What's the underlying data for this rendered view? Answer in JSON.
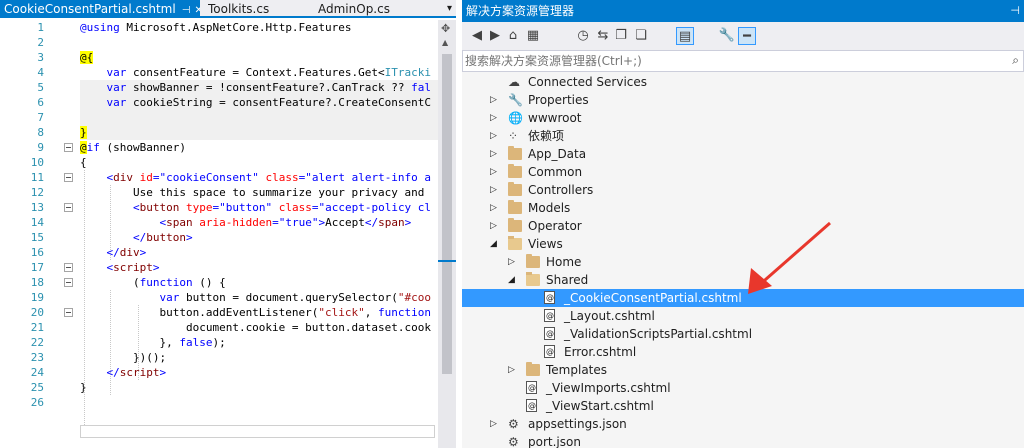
{
  "editor": {
    "tabs": [
      {
        "label": "CookieConsentPartial.cshtml",
        "active": true
      },
      {
        "label": "Toolkits.cs",
        "active": false
      },
      {
        "label": "AdminOp.cs",
        "active": false
      }
    ],
    "lines": [
      {
        "n": "1",
        "fold": false,
        "tokens": [
          [
            "t-kw",
            "@using"
          ],
          [
            "t-txt",
            " Microsoft.AspNetCore.Http.Features"
          ]
        ]
      },
      {
        "n": "2",
        "fold": false,
        "tokens": []
      },
      {
        "n": "3",
        "fold": false,
        "tokens": [
          [
            "t-razor",
            "@{"
          ]
        ]
      },
      {
        "n": "4",
        "fold": false,
        "tokens": [
          [
            "t-txt",
            "    "
          ],
          [
            "t-kw",
            "var"
          ],
          [
            "t-txt",
            " consentFeature = Context.Features.Get<"
          ],
          [
            "t-tp",
            "ITracki"
          ]
        ]
      },
      {
        "n": "5",
        "fold": false,
        "tokens": [
          [
            "t-txt",
            "    "
          ],
          [
            "t-kw",
            "var"
          ],
          [
            "t-txt",
            " showBanner = !consentFeature?.CanTrack ?? "
          ],
          [
            "t-kw",
            "fal"
          ]
        ]
      },
      {
        "n": "6",
        "fold": false,
        "tokens": [
          [
            "t-txt",
            "    "
          ],
          [
            "t-kw",
            "var"
          ],
          [
            "t-txt",
            " cookieString = consentFeature?.CreateConsentC"
          ]
        ]
      },
      {
        "n": "7",
        "fold": false,
        "tokens": []
      },
      {
        "n": "8",
        "fold": false,
        "tokens": [
          [
            "t-razor",
            "}"
          ]
        ]
      },
      {
        "n": "9",
        "fold": true,
        "tokens": [
          [
            "t-at",
            "@"
          ],
          [
            "t-kw",
            "if"
          ],
          [
            "t-txt",
            " (showBanner)"
          ]
        ]
      },
      {
        "n": "10",
        "fold": false,
        "tokens": [
          [
            "t-txt",
            "{"
          ]
        ]
      },
      {
        "n": "11",
        "fold": true,
        "tokens": [
          [
            "t-txt",
            "    "
          ],
          [
            "t-punc",
            "<"
          ],
          [
            "t-tag",
            "div"
          ],
          [
            "t-txt",
            " "
          ],
          [
            "t-attr",
            "id"
          ],
          [
            "t-punc",
            "="
          ],
          [
            "t-kw",
            "\"cookieConsent\""
          ],
          [
            "t-txt",
            " "
          ],
          [
            "t-attr",
            "class"
          ],
          [
            "t-punc",
            "="
          ],
          [
            "t-kw",
            "\"alert alert-info a"
          ]
        ]
      },
      {
        "n": "12",
        "fold": false,
        "tokens": [
          [
            "t-txt",
            "        Use this space to summarize your privacy and "
          ]
        ]
      },
      {
        "n": "13",
        "fold": true,
        "tokens": [
          [
            "t-txt",
            "        "
          ],
          [
            "t-punc",
            "<"
          ],
          [
            "t-tag",
            "button"
          ],
          [
            "t-txt",
            " "
          ],
          [
            "t-attr",
            "type"
          ],
          [
            "t-punc",
            "="
          ],
          [
            "t-kw",
            "\"button\""
          ],
          [
            "t-txt",
            " "
          ],
          [
            "t-attr",
            "class"
          ],
          [
            "t-punc",
            "="
          ],
          [
            "t-kw",
            "\"accept-policy cl"
          ]
        ]
      },
      {
        "n": "14",
        "fold": false,
        "tokens": [
          [
            "t-txt",
            "            "
          ],
          [
            "t-punc",
            "<"
          ],
          [
            "t-tag",
            "span"
          ],
          [
            "t-txt",
            " "
          ],
          [
            "t-attr",
            "aria-hidden"
          ],
          [
            "t-punc",
            "="
          ],
          [
            "t-kw",
            "\"true\""
          ],
          [
            "t-punc",
            ">"
          ],
          [
            "t-txt",
            "Accept"
          ],
          [
            "t-punc",
            "</"
          ],
          [
            "t-tag",
            "span"
          ],
          [
            "t-punc",
            ">"
          ]
        ]
      },
      {
        "n": "15",
        "fold": false,
        "tokens": [
          [
            "t-txt",
            "        "
          ],
          [
            "t-punc",
            "</"
          ],
          [
            "t-tag",
            "button"
          ],
          [
            "t-punc",
            ">"
          ]
        ]
      },
      {
        "n": "16",
        "fold": false,
        "tokens": [
          [
            "t-txt",
            "    "
          ],
          [
            "t-punc",
            "</"
          ],
          [
            "t-tag",
            "div"
          ],
          [
            "t-punc",
            ">"
          ]
        ]
      },
      {
        "n": "17",
        "fold": true,
        "tokens": [
          [
            "t-txt",
            "    "
          ],
          [
            "t-punc",
            "<"
          ],
          [
            "t-tag",
            "script"
          ],
          [
            "t-punc",
            ">"
          ]
        ]
      },
      {
        "n": "18",
        "fold": true,
        "tokens": [
          [
            "t-txt",
            "        ("
          ],
          [
            "t-kw",
            "function"
          ],
          [
            "t-txt",
            " () {"
          ]
        ]
      },
      {
        "n": "19",
        "fold": false,
        "tokens": [
          [
            "t-txt",
            "            "
          ],
          [
            "t-kw",
            "var"
          ],
          [
            "t-txt",
            " button = document.querySelector("
          ],
          [
            "t-str",
            "\"#coo"
          ]
        ]
      },
      {
        "n": "20",
        "fold": true,
        "tokens": [
          [
            "t-txt",
            "            button.addEventListener("
          ],
          [
            "t-str",
            "\"click\""
          ],
          [
            "t-txt",
            ", "
          ],
          [
            "t-kw",
            "function"
          ]
        ]
      },
      {
        "n": "21",
        "fold": false,
        "tokens": [
          [
            "t-txt",
            "                document.cookie = button.dataset.cook"
          ]
        ]
      },
      {
        "n": "22",
        "fold": false,
        "tokens": [
          [
            "t-txt",
            "            }, "
          ],
          [
            "t-kw",
            "false"
          ],
          [
            "t-txt",
            ");"
          ]
        ]
      },
      {
        "n": "23",
        "fold": false,
        "tokens": [
          [
            "t-txt",
            "        })();"
          ]
        ]
      },
      {
        "n": "24",
        "fold": false,
        "tokens": [
          [
            "t-txt",
            "    "
          ],
          [
            "t-punc",
            "</"
          ],
          [
            "t-tag",
            "script"
          ],
          [
            "t-punc",
            ">"
          ]
        ]
      },
      {
        "n": "25",
        "fold": false,
        "tokens": [
          [
            "t-txt",
            "}"
          ]
        ]
      },
      {
        "n": "26",
        "fold": false,
        "tokens": []
      }
    ]
  },
  "solution_explorer": {
    "title": "解决方案资源管理器",
    "search_placeholder": "搜索解决方案资源管理器(Ctrl+;)",
    "toolbar": [
      {
        "name": "back-icon",
        "glyph": "◀"
      },
      {
        "name": "forward-icon",
        "glyph": "▶"
      },
      {
        "name": "home-icon",
        "glyph": "⌂"
      },
      {
        "name": "switch-views-icon",
        "glyph": "▦"
      },
      {
        "name": "pending-changes-icon",
        "glyph": "◷"
      },
      {
        "name": "sync-icon",
        "glyph": "⇆"
      },
      {
        "name": "collapse-all-icon",
        "glyph": "❐"
      },
      {
        "name": "show-all-files-icon",
        "glyph": "❏"
      },
      {
        "name": "preview-selected-icon",
        "glyph": "▤"
      },
      {
        "name": "properties-icon",
        "glyph": "🔧"
      },
      {
        "name": "minus-icon",
        "glyph": "━"
      }
    ],
    "items": [
      {
        "label": "Connected Services",
        "icon": "cloud-icon",
        "glyph": "☁",
        "depth": 0,
        "expander": "",
        "selected": false
      },
      {
        "label": "Properties",
        "icon": "wrench-icon",
        "glyph": "🔧",
        "depth": 0,
        "expander": "▷",
        "selected": false
      },
      {
        "label": "wwwroot",
        "icon": "globe-icon",
        "glyph": "🌐",
        "depth": 0,
        "expander": "▷",
        "selected": false
      },
      {
        "label": "依赖项",
        "icon": "dependencies-icon",
        "glyph": "⁘",
        "depth": 0,
        "expander": "▷",
        "selected": false
      },
      {
        "label": "App_Data",
        "icon": "folder-icon",
        "glyph": "",
        "depth": 0,
        "expander": "▷",
        "selected": false
      },
      {
        "label": "Common",
        "icon": "folder-icon",
        "glyph": "",
        "depth": 0,
        "expander": "▷",
        "selected": false
      },
      {
        "label": "Controllers",
        "icon": "folder-icon",
        "glyph": "",
        "depth": 0,
        "expander": "▷",
        "selected": false
      },
      {
        "label": "Models",
        "icon": "folder-icon",
        "glyph": "",
        "depth": 0,
        "expander": "▷",
        "selected": false
      },
      {
        "label": "Operator",
        "icon": "folder-icon",
        "glyph": "",
        "depth": 0,
        "expander": "▷",
        "selected": false
      },
      {
        "label": "Views",
        "icon": "folder-open-icon",
        "glyph": "",
        "depth": 0,
        "expander": "◢",
        "selected": false
      },
      {
        "label": "Home",
        "icon": "folder-icon",
        "glyph": "",
        "depth": 1,
        "expander": "▷",
        "selected": false
      },
      {
        "label": "Shared",
        "icon": "folder-open-icon",
        "glyph": "",
        "depth": 1,
        "expander": "◢",
        "selected": false
      },
      {
        "label": "_CookieConsentPartial.cshtml",
        "icon": "razor-file-icon",
        "glyph": "",
        "depth": 2,
        "expander": "",
        "selected": true
      },
      {
        "label": "_Layout.cshtml",
        "icon": "razor-file-icon",
        "glyph": "",
        "depth": 2,
        "expander": "",
        "selected": false
      },
      {
        "label": "_ValidationScriptsPartial.cshtml",
        "icon": "razor-file-icon",
        "glyph": "",
        "depth": 2,
        "expander": "",
        "selected": false
      },
      {
        "label": "Error.cshtml",
        "icon": "razor-file-icon",
        "glyph": "",
        "depth": 2,
        "expander": "",
        "selected": false
      },
      {
        "label": "Templates",
        "icon": "folder-icon",
        "glyph": "",
        "depth": 1,
        "expander": "▷",
        "selected": false
      },
      {
        "label": "_ViewImports.cshtml",
        "icon": "razor-file-icon",
        "glyph": "",
        "depth": 1,
        "expander": "",
        "selected": false
      },
      {
        "label": "_ViewStart.cshtml",
        "icon": "razor-file-icon",
        "glyph": "",
        "depth": 1,
        "expander": "",
        "selected": false
      },
      {
        "label": "appsettings.json",
        "icon": "json-file-icon",
        "glyph": "⚙",
        "depth": 0,
        "expander": "▷",
        "selected": false
      },
      {
        "label": "port.json",
        "icon": "json-file-icon",
        "glyph": "⚙",
        "depth": 0,
        "expander": "",
        "selected": false
      }
    ]
  },
  "colors": {
    "accent": "#007acc",
    "selection": "#3399ff",
    "annotation_arrow": "#e8372c"
  }
}
